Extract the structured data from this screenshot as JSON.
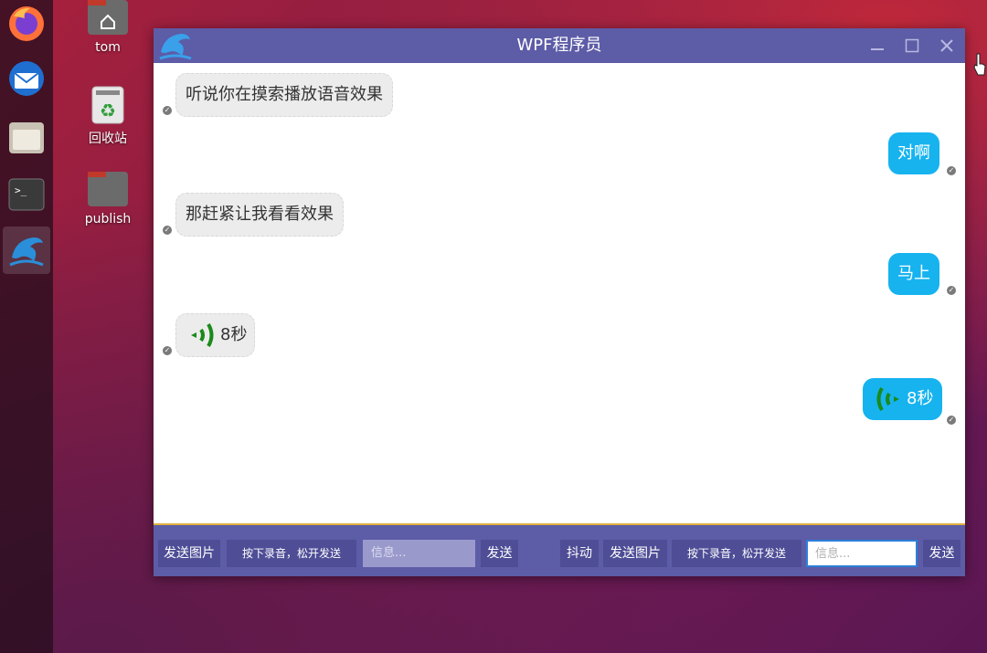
{
  "desktop": {
    "icons": [
      {
        "label": "tom"
      },
      {
        "label": "回收站"
      },
      {
        "label": "publish"
      }
    ]
  },
  "window": {
    "title": "WPF程序员",
    "accent_color": "#5d5ca7"
  },
  "messages": [
    {
      "side": "left",
      "text": "听说你在摸索播放语音效果"
    },
    {
      "side": "right",
      "text": "对啊"
    },
    {
      "side": "left",
      "text": "那赶紧让我看看效果"
    },
    {
      "side": "right",
      "text": "马上"
    },
    {
      "side": "left",
      "voice_duration": "8秒"
    },
    {
      "side": "right",
      "voice_duration": "8秒"
    }
  ],
  "bottom_bar": {
    "left": {
      "send_image": "发送图片",
      "record_hint": "按下录音，松开发送",
      "input_placeholder": "信息...",
      "send": "发送"
    },
    "right": {
      "shake": "抖动",
      "send_image": "发送图片",
      "record_hint": "按下录音，松开发送",
      "input_placeholder": "信息...",
      "send": "发送"
    }
  },
  "colors": {
    "bubble_right": "#16b3ef",
    "bubble_left": "#ececec",
    "voice_icon": "#1a8a1a"
  }
}
